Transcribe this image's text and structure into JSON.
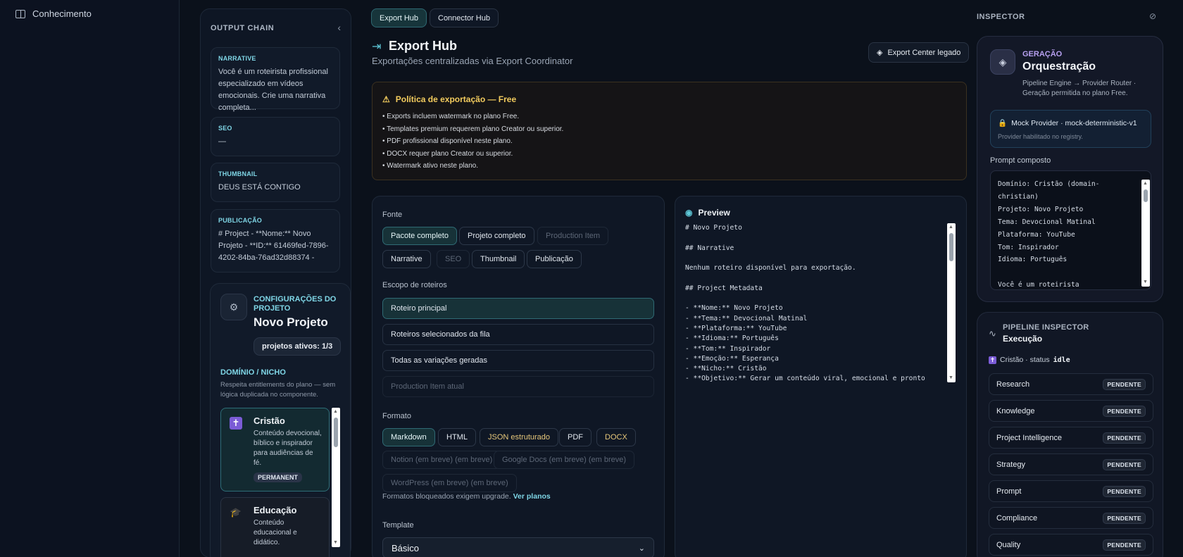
{
  "nav": {
    "item_label": "Conhecimento"
  },
  "output_chain": {
    "title": "OUTPUT CHAIN",
    "cards": [
      {
        "label": "NARRATIVE",
        "text": "Você é um roteirista profissional especializado em vídeos emocionais. Crie uma narrativa completa..."
      },
      {
        "label": "SEO",
        "text": "—"
      },
      {
        "label": "THUMBNAIL",
        "text": "DEUS ESTÁ CONTIGO"
      },
      {
        "label": "PUBLICAÇÃO",
        "text": "# Project - **Nome:** Novo Projeto - **ID:** 61469fed-7896-4202-84ba-76ad32d88374 - **Estágio atual:**..."
      }
    ]
  },
  "config": {
    "subtitle": "CONFIGURAÇÕES DO PROJETO",
    "title": "Novo Projeto",
    "badge": "projetos ativos: 1/3",
    "domain_heading": "DOMÍNIO / NICHO",
    "domain_desc": "Respeita entitlements do plano — sem lógica duplicada no componente.",
    "domains": [
      {
        "title": "Cristão",
        "desc": "Conteúdo devocional, bíblico e inspirador para audiências de fé.",
        "tag": "PERMANENT"
      },
      {
        "title": "Educação",
        "desc": "Conteúdo educacional e didático."
      }
    ]
  },
  "tabs": [
    {
      "label": "Export Hub"
    },
    {
      "label": "Connector Hub"
    }
  ],
  "header": {
    "title": "Export Hub",
    "subtitle": "Exportações centralizadas via Export Coordinator",
    "legacy_button": "Export Center legado"
  },
  "policy": {
    "title": "Política de exportação — Free",
    "items": [
      "• Exports incluem watermark no plano Free.",
      "• Templates premium requerem plano Creator ou superior.",
      "• PDF profissional disponível neste plano.",
      "• DOCX requer plano Creator ou superior.",
      "• Watermark ativo neste plano."
    ]
  },
  "source": {
    "fonte_label": "Fonte",
    "fonte_chips": [
      "Pacote completo",
      "Projeto completo",
      "Production Item",
      "Narrative",
      "SEO",
      "Thumbnail",
      "Publicação"
    ],
    "escopo_label": "Escopo de roteiros",
    "escopo_options": [
      "Roteiro principal",
      "Roteiros selecionados da fila",
      "Todas as variações geradas",
      "Production Item atual"
    ],
    "formato_label": "Formato",
    "formato_chips": [
      "Markdown",
      "HTML",
      "JSON estruturado",
      "PDF",
      "DOCX",
      "Notion (em breve) (em breve)",
      "Google Docs (em breve) (em breve)",
      "WordPress (em breve) (em breve)"
    ],
    "hint": "Formatos bloqueados exigem upgrade.",
    "hint_link": "Ver planos",
    "template_label": "Template",
    "template_value": "Básico"
  },
  "preview": {
    "title": "Preview",
    "content": "# Novo Projeto\n\n## Narrative\n\nNenhum roteiro disponível para exportação.\n\n## Project Metadata\n\n- **Nome:** Novo Projeto\n- **Tema:** Devocional Matinal\n- **Plataforma:** YouTube\n- **Idioma:** Português\n- **Tom:** Inspirador\n- **Emoção:** Esperança\n- **Nicho:** Cristão\n- **Objetivo:** Gerar um conteúdo viral, emocional e pronto"
  },
  "inspector": {
    "title": "INSPECTOR",
    "gen_sub": "GERAÇÃO",
    "gen_title": "Orquestração",
    "gen_desc": "Pipeline Engine → Provider Router · Geração permitida no plano Free.",
    "mock_title": "Mock Provider · mock-deterministic-v1",
    "mock_desc": "Provider habilitado no registry.",
    "prompt_label": "Prompt composto",
    "prompt_text": "Domínio: Cristão (domain-christian)\nProjeto: Novo Projeto\nTema: Devocional Matinal\nPlataforma: YouTube\nTom: Inspirador\nIdioma: Português\n\nVocê é um roteirista",
    "pipe_sub": "PIPELINE INSPECTOR",
    "pipe_title": "Execução",
    "status_prefix": "Cristão · status",
    "status_value": "idle",
    "stages": [
      "Research",
      "Knowledge",
      "Project Intelligence",
      "Strategy",
      "Prompt",
      "Compliance",
      "Quality"
    ],
    "stage_status": "PENDENTE"
  }
}
